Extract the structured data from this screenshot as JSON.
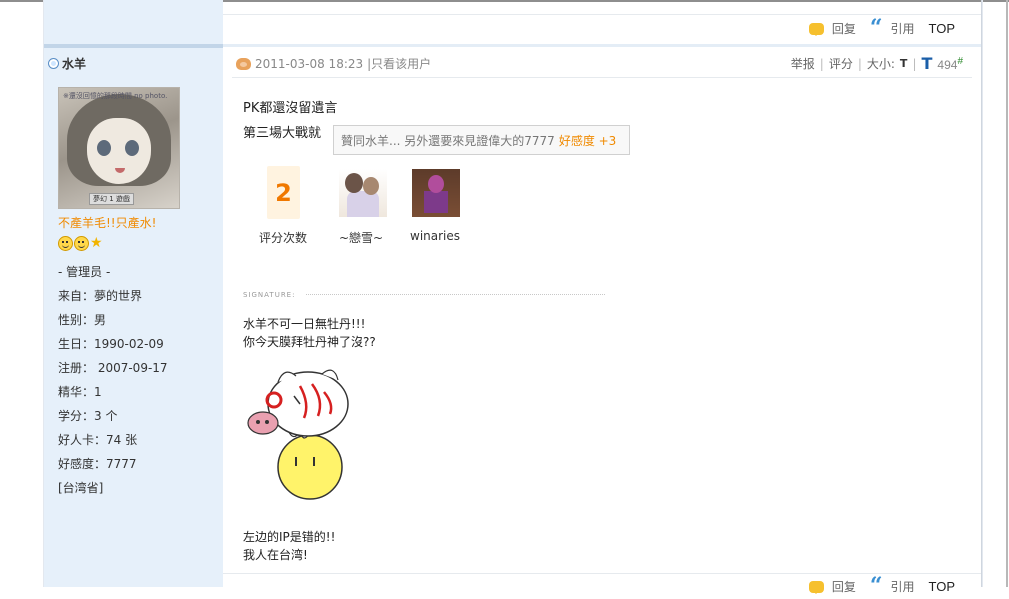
{
  "actions": {
    "reply": "回复",
    "quote": "引用",
    "top": "TOP"
  },
  "user": {
    "name": "水羊",
    "avatar_caption": "※還沒回憶的那段時間 no photo.",
    "avatar_tag": "夢幻 1 遊戲",
    "custom_title": "不產羊毛!!只產水!",
    "group": "- 管理员 -",
    "from": "来自：夢的世界",
    "gender": "性别：男",
    "birthday": "生日：1990-02-09",
    "registered": "注册： 2007-09-17",
    "digest": "精华：1",
    "credits": "学分：3 个",
    "good_cards": "好人卡：74 张",
    "karma": "好感度：7777",
    "location": "[台湾省]"
  },
  "post": {
    "date": "2011-03-08 18:23",
    "only_author": "|只看该用户",
    "report": "举报",
    "rate": "评分",
    "size": "大小:",
    "t_small": "T",
    "t_big": "T",
    "floor": "494",
    "floor_mark": "#",
    "line1": "PK都還沒留遺言",
    "line2": "第三場大戰就",
    "tooltip_text": "贊同水羊... 另外還要來見證偉大的7777",
    "tooltip_karma": "好感度 +3",
    "rating_count": "2",
    "rating_label": "评分次数",
    "raters": [
      "~戀雪~",
      "winaries"
    ]
  },
  "signature": {
    "label": "SIGNATURE:",
    "line1": "水羊不可一日無牡丹!!!",
    "line2": "你今天膜拜牡丹神了沒??",
    "bottom1": "左边的IP是错的!!",
    "bottom2": "我人在台湾!"
  }
}
